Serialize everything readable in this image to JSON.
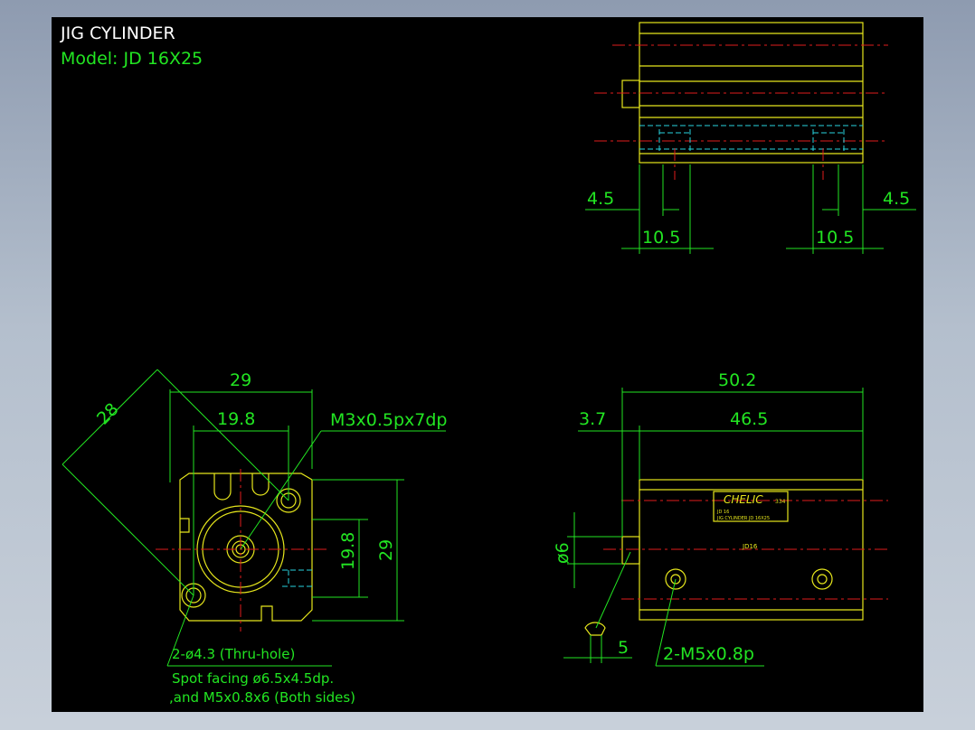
{
  "title": {
    "line1": "JIG CYLINDER",
    "line2": "Model:  JD 16X25"
  },
  "dimensions": {
    "top_left_a": "4.5",
    "top_right_a": "4.5",
    "top_left_b": "10.5",
    "top_right_b": "10.5",
    "front_width": "29",
    "front_diag": "28",
    "front_inner": "19.8",
    "front_vert_inner": "19.8",
    "front_vert": "29",
    "side_total": "50.2",
    "side_body": "46.5",
    "side_offset": "3.7",
    "side_port_dia": "ø6",
    "side_small": "5"
  },
  "notes": {
    "thread": "M3x0.5px7dp",
    "hole_1": "2-ø4.3 (Thru-hole)",
    "hole_2": "Spot facing  ø6.5x4.5dp.",
    "hole_3": ",and M5x0.8x6 (Both sides)",
    "port": "2-M5x0.8p"
  },
  "label": {
    "brand": "CHELIC",
    "suffix": "334",
    "line1": "JD 16",
    "line2": "JIG CYLINDER  JD 16X25",
    "model_mark": "JD16"
  },
  "colors": {
    "background": "#000000",
    "outline": "#e6e61c",
    "dimension": "#22e522",
    "centerline": "#e01b1b",
    "hidden": "#27d5e0"
  }
}
